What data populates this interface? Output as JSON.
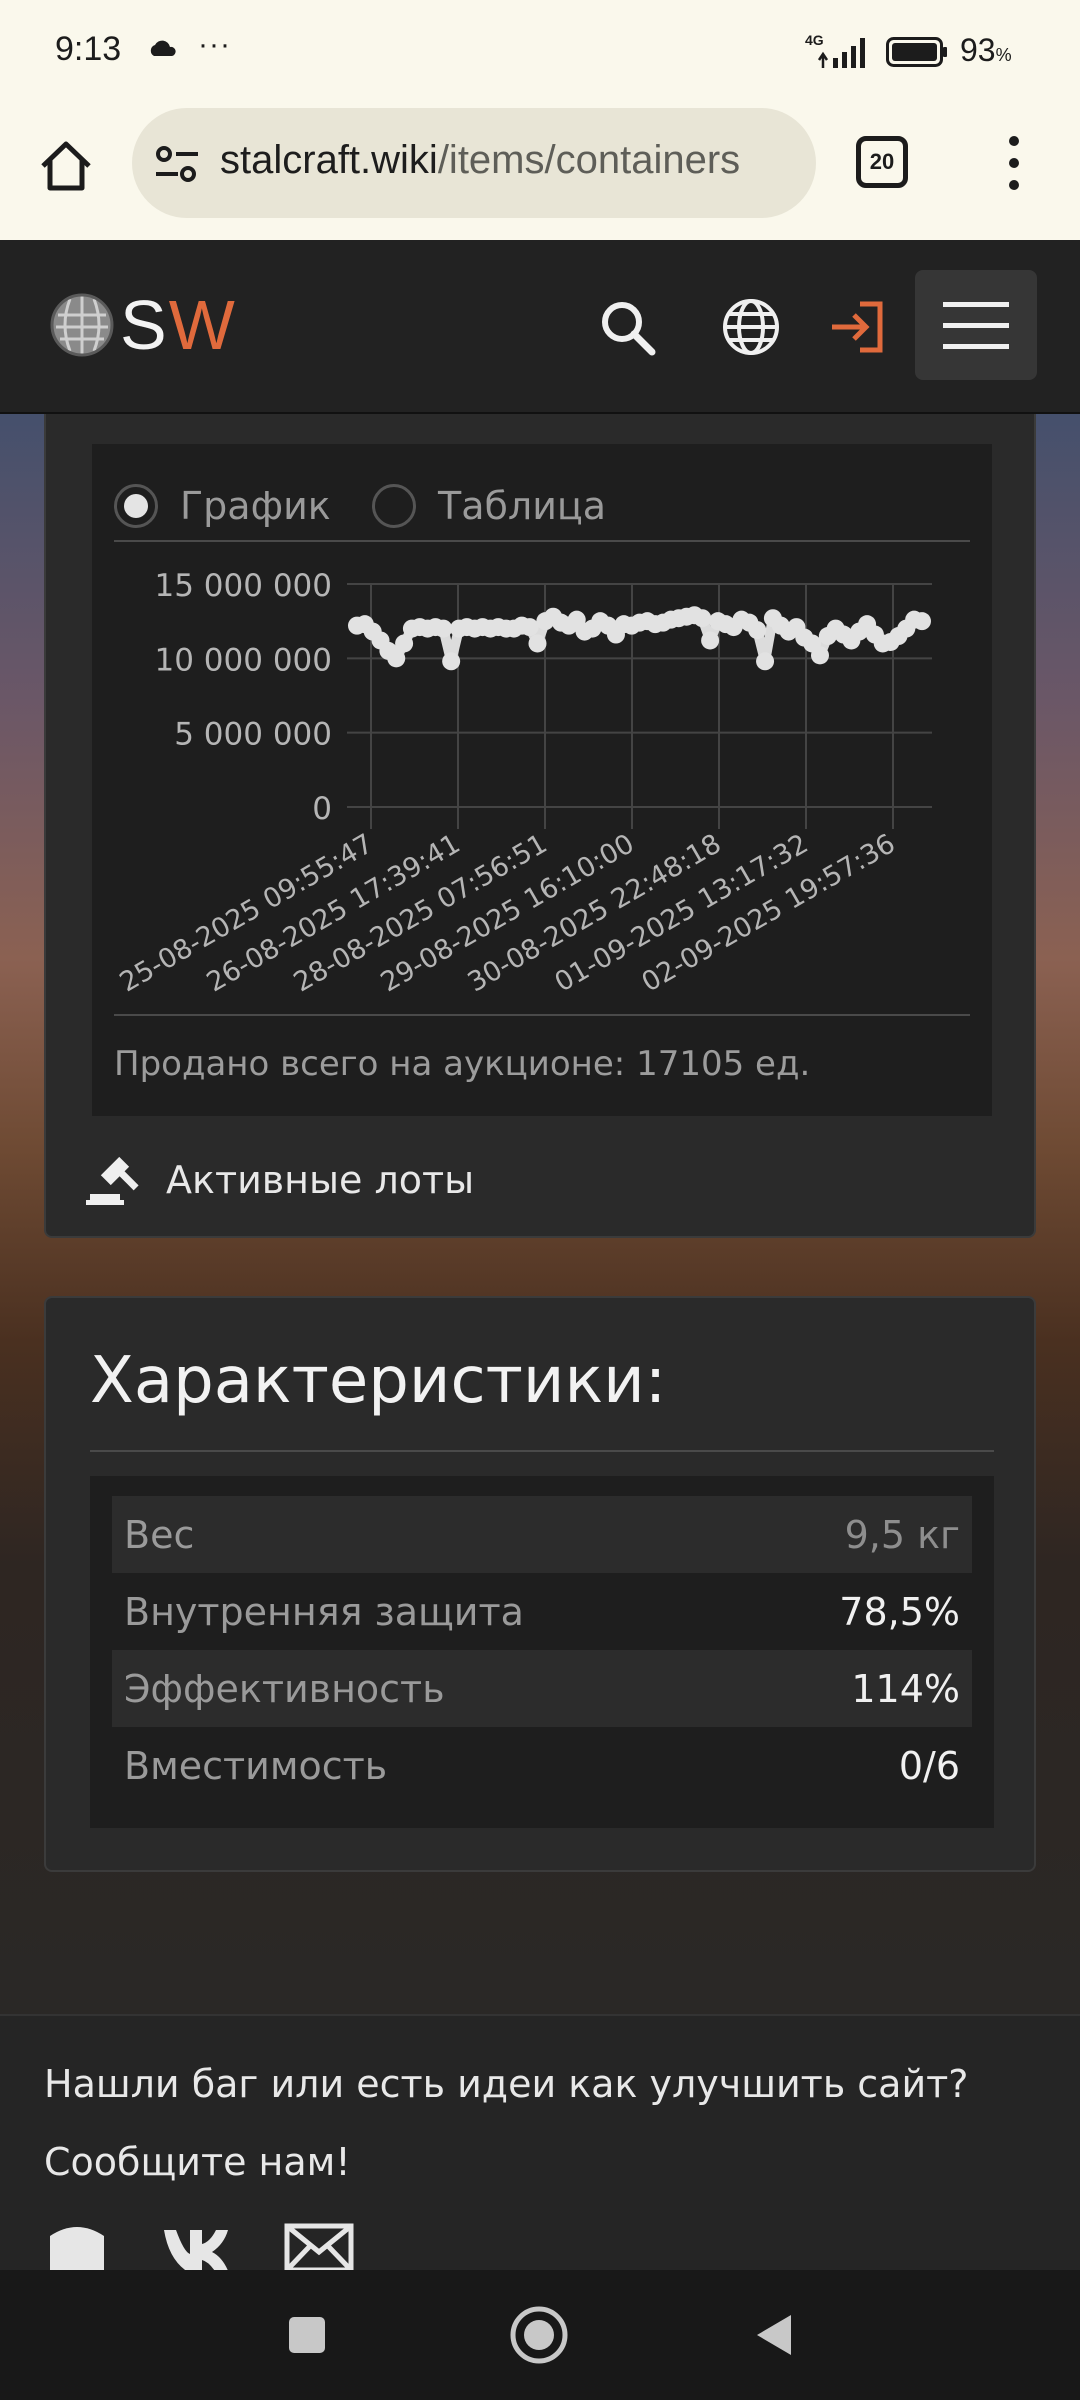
{
  "status_bar": {
    "time": "9:13",
    "dots": "···",
    "network": "4G",
    "battery_pct": "93",
    "battery_unit": "%"
  },
  "browser": {
    "url_host": "stalcraft.wiki",
    "url_path": "/items/containers",
    "tab_count": "20"
  },
  "site_header": {
    "logo_s": "S",
    "logo_w": "W",
    "accent_color": "#e06a3c"
  },
  "price_history": {
    "view_options": [
      "График",
      "Таблица"
    ],
    "selected_view": "График",
    "sold_total": "Продано всего на аукционе: 17105 ед.",
    "active_lots": "Активные лоты"
  },
  "chart_data": {
    "type": "scatter",
    "y_ticks": [
      "15 000 000",
      "10 000 000",
      "5 000 000",
      "0"
    ],
    "ylim": [
      0,
      15000000
    ],
    "x_ticks": [
      "25-08-2025 09:55:47",
      "26-08-2025 17:39:41",
      "28-08-2025 07:56:51",
      "29-08-2025 16:10:00",
      "30-08-2025 22:48:18",
      "01-09-2025 13:17:32",
      "02-09-2025 19:57:36"
    ],
    "grid": true,
    "values": [
      12200000,
      12300000,
      11800000,
      11200000,
      10500000,
      10000000,
      11000000,
      12000000,
      12100000,
      12000000,
      12100000,
      12000000,
      9800000,
      12000000,
      12100000,
      12000000,
      12100000,
      12000000,
      12100000,
      12000000,
      12000000,
      12200000,
      12100000,
      11000000,
      12500000,
      12800000,
      12400000,
      12200000,
      12600000,
      11800000,
      12000000,
      12500000,
      12200000,
      11600000,
      12300000,
      12200000,
      12400000,
      12500000,
      12300000,
      12400000,
      12600000,
      12700000,
      12800000,
      12900000,
      12700000,
      11200000,
      12500000,
      12300000,
      12100000,
      12600000,
      12400000,
      11900000,
      9800000,
      12700000,
      12200000,
      11800000,
      12100000,
      11400000,
      11000000,
      10200000,
      11500000,
      12000000,
      11600000,
      11200000,
      11800000,
      12300000,
      11600000,
      11000000,
      11100000,
      11500000,
      12000000,
      12600000,
      12500000
    ]
  },
  "characteristics": {
    "title": "Характеристики:",
    "rows": [
      {
        "label": "Вес",
        "value": "9,5 кг"
      },
      {
        "label": "Внутренняя защита",
        "value": "78,5%"
      },
      {
        "label": "Эффективность",
        "value": "114%"
      },
      {
        "label": "Вместимость",
        "value": "0/6"
      }
    ]
  },
  "footer": {
    "line1": "Нашли баг или есть идеи как улучшить сайт?",
    "line2": "Сообщите нам!"
  }
}
